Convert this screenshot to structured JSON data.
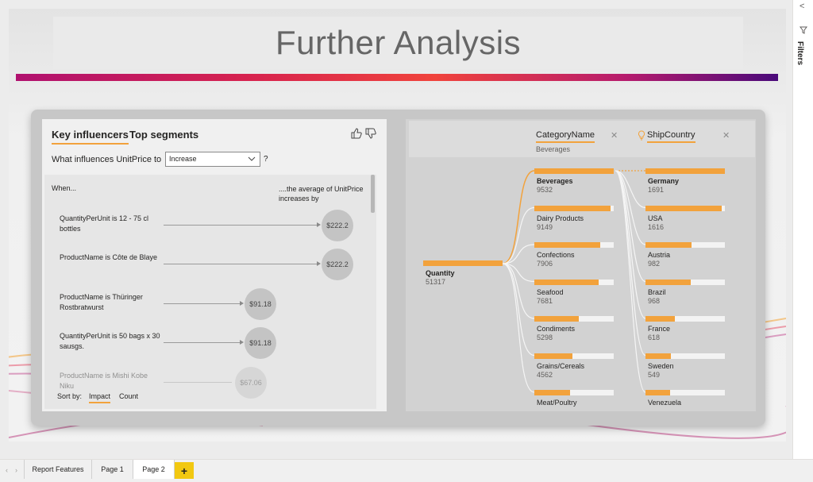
{
  "report": {
    "title": "Further Analysis"
  },
  "key_influencers": {
    "tabs": [
      "Key influencers",
      "Top segments"
    ],
    "question_prefix": "What influences UnitPrice to",
    "dropdown_value": "Increase",
    "question_mark": "?",
    "col_when": "When...",
    "col_avg": "....the average of UnitPrice increases by",
    "influencers": [
      {
        "label": "QuantityPerUnit is 12 - 75 cl bottles",
        "value": "$222.2"
      },
      {
        "label": "ProductName is Côte de Blaye",
        "value": "$222.2"
      },
      {
        "label": "ProductName is Thüringer Rostbratwurst",
        "value": "$91.18"
      },
      {
        "label": "QuantityPerUnit is 50 bags x 30 sausgs.",
        "value": "$91.18"
      },
      {
        "label": "ProductName is Mishi Kobe Niku",
        "value": "$67.06"
      }
    ],
    "sort_by_label": "Sort by:",
    "sort_options": [
      "Impact",
      "Count"
    ]
  },
  "decomposition_tree": {
    "columns": [
      {
        "title": "CategoryName",
        "subtitle": "Beverages"
      },
      {
        "title": "ShipCountry",
        "subtitle": ""
      }
    ],
    "root": {
      "name": "Quantity",
      "value": "51317"
    },
    "categories": [
      {
        "name": "Beverages",
        "value": "9532",
        "fill": 1.0,
        "selected": true
      },
      {
        "name": "Dairy Products",
        "value": "9149",
        "fill": 0.96
      },
      {
        "name": "Confections",
        "value": "7906",
        "fill": 0.83
      },
      {
        "name": "Seafood",
        "value": "7681",
        "fill": 0.81
      },
      {
        "name": "Condiments",
        "value": "5298",
        "fill": 0.56
      },
      {
        "name": "Grains/Cereals",
        "value": "4562",
        "fill": 0.48
      },
      {
        "name": "Meat/Poultry",
        "value": "",
        "fill": 0.45
      }
    ],
    "countries": [
      {
        "name": "Germany",
        "value": "1691",
        "fill": 1.0,
        "selected": true
      },
      {
        "name": "USA",
        "value": "1616",
        "fill": 0.96
      },
      {
        "name": "Austria",
        "value": "982",
        "fill": 0.58
      },
      {
        "name": "Brazil",
        "value": "968",
        "fill": 0.57
      },
      {
        "name": "France",
        "value": "618",
        "fill": 0.37
      },
      {
        "name": "Sweden",
        "value": "549",
        "fill": 0.32
      },
      {
        "name": "Venezuela",
        "value": "",
        "fill": 0.31
      }
    ]
  },
  "filters_pane": {
    "label": "Filters",
    "collapse_glyph": "<"
  },
  "page_tabs": {
    "tabs": [
      "Report Features",
      "Page 1",
      "Page 2"
    ],
    "active": "Page 2",
    "add_label": "+"
  },
  "colors": {
    "accent": "#f2a23c",
    "bubble": "#c4c4c4",
    "add_page": "#f2c811"
  }
}
